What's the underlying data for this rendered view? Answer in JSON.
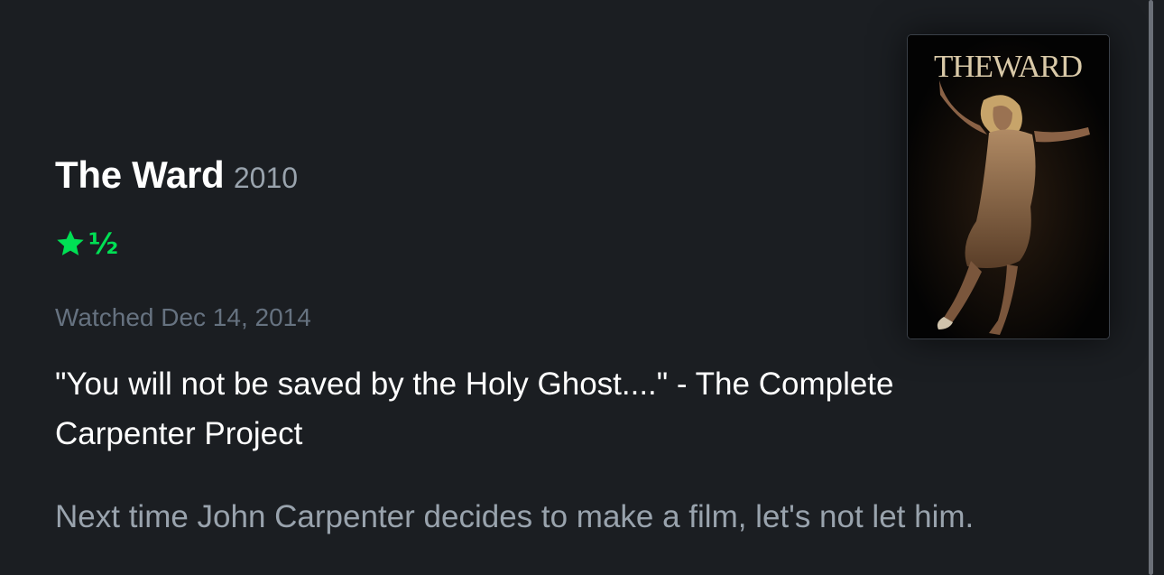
{
  "film": {
    "title": "The Ward",
    "year": "2010"
  },
  "rating": {
    "stars": 1.5,
    "max_stars": 5,
    "half_glyph": "½",
    "color": "#00e054"
  },
  "watched_label": "Watched Dec 14, 2014",
  "review": {
    "paragraphs": [
      "\"You will not be saved by the Holy Ghost....\" - The Complete Carpenter Project",
      "Next time John Carpenter decides to make a film, let's not let him."
    ]
  },
  "poster": {
    "title_text": "THEWARD"
  }
}
